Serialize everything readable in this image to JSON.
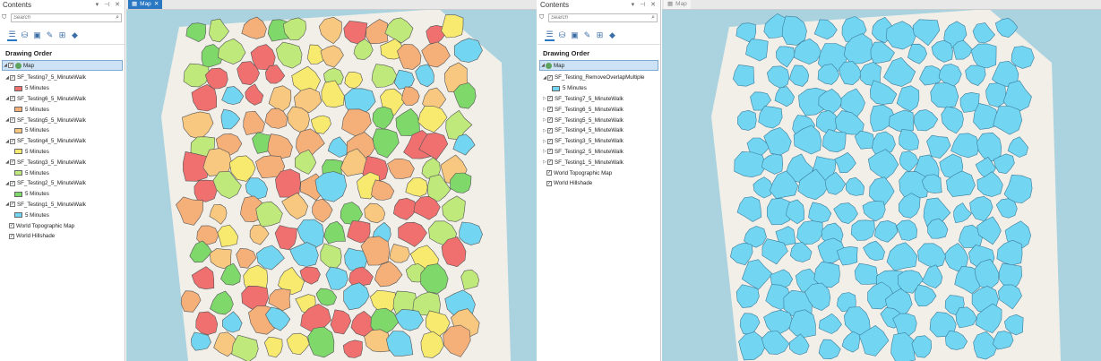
{
  "colors": {
    "red": "#f07070",
    "orange": "#f5b07a",
    "yellow": "#f8ea6e",
    "lime": "#bfe97a",
    "green": "#7ed86a",
    "cyan": "#72d6f2",
    "land": "#f2efe9",
    "water": "#aad3df"
  },
  "left": {
    "panel_title": "Contents",
    "controls": "▾ ⊣ ✕",
    "search_placeholder": "Search",
    "drawing_order": "Drawing Order",
    "map_label": "Map",
    "layers": [
      {
        "name": "SF_Testing7_5_MinuteWalk",
        "legend": "5 Minutes",
        "color": "#f07070"
      },
      {
        "name": "SF_Testing6_5_MinuteWalk",
        "legend": "5 Minutes",
        "color": "#f5b07a"
      },
      {
        "name": "SF_Testing5_5_MinuteWalk",
        "legend": "5 Minutes",
        "color": "#f8c880"
      },
      {
        "name": "SF_Testing4_5_MinuteWalk",
        "legend": "5 Minutes",
        "color": "#f8ea6e"
      },
      {
        "name": "SF_Testing3_5_MinuteWalk",
        "legend": "5 Minutes",
        "color": "#bfe97a"
      },
      {
        "name": "SF_Testing2_5_MinuteWalk",
        "legend": "5 Minutes",
        "color": "#7ed86a"
      },
      {
        "name": "SF_Testing1_5_MinuteWalk",
        "legend": "5 Minutes",
        "color": "#72d6f2"
      }
    ],
    "basemaps": [
      "World Topographic Map",
      "World Hillshade"
    ],
    "tab_label": "Map"
  },
  "right": {
    "panel_title": "Contents",
    "controls": "▾ ⊣ ✕",
    "search_placeholder": "Search",
    "drawing_order": "Drawing Order",
    "map_label": "Map",
    "merged_layer": {
      "name": "SF_Testing_RemoveOverlapMultiple",
      "legend": "5 Minutes",
      "color": "#72d6f2"
    },
    "layers": [
      "SF_Testing7_5_MinuteWalk",
      "SF_Testing6_5_MinuteWalk",
      "SF_Testing5_5_MinuteWalk",
      "SF_Testing4_5_MinuteWalk",
      "SF_Testing3_5_MinuteWalk",
      "SF_Testing2_5_MinuteWalk",
      "SF_Testing1_5_MinuteWalk"
    ],
    "basemaps": [
      "World Topographic Map",
      "World Hillshade"
    ],
    "tab_label": "Map"
  },
  "icons": {
    "filter": "filter-icon",
    "search": "search-icon",
    "list_by_drawing_order": "drawing-order-icon",
    "data_source": "database-icon",
    "selection": "selection-icon",
    "editing": "pencil-icon",
    "snapping": "snapping-icon",
    "labeling": "label-icon"
  }
}
